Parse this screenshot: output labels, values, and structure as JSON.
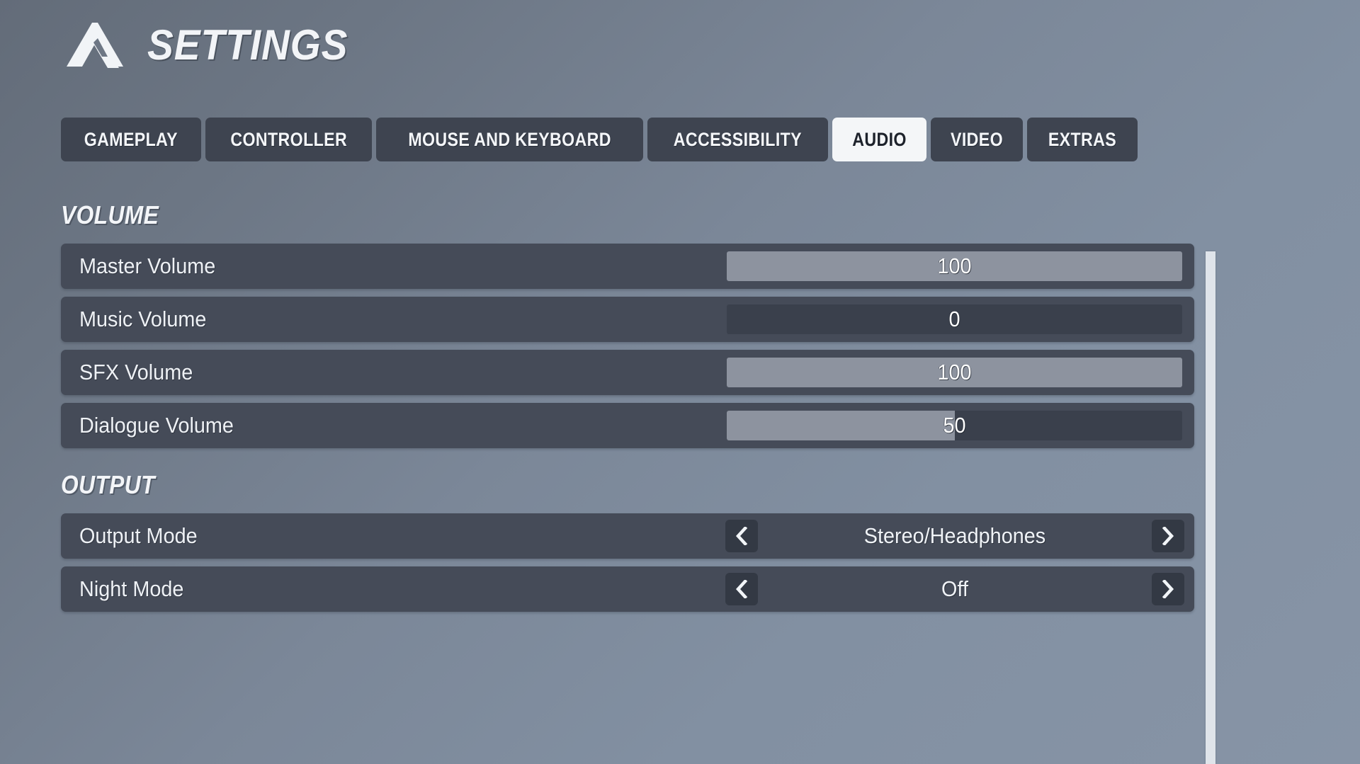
{
  "header": {
    "title": "SETTINGS",
    "logo_icon": "mountain-peak-logo-icon"
  },
  "tabs": [
    {
      "label": "GAMEPLAY",
      "active": false
    },
    {
      "label": "CONTROLLER",
      "active": false
    },
    {
      "label": "MOUSE AND KEYBOARD",
      "active": false
    },
    {
      "label": "ACCESSIBILITY",
      "active": false
    },
    {
      "label": "AUDIO",
      "active": true
    },
    {
      "label": "VIDEO",
      "active": false
    },
    {
      "label": "EXTRAS",
      "active": false
    }
  ],
  "sections": {
    "volume": {
      "title": "VOLUME",
      "rows": [
        {
          "label": "Master Volume",
          "value": "100",
          "percent": 100
        },
        {
          "label": "Music Volume",
          "value": "0",
          "percent": 0
        },
        {
          "label": "SFX Volume",
          "value": "100",
          "percent": 100
        },
        {
          "label": "Dialogue Volume",
          "value": "50",
          "percent": 50
        }
      ]
    },
    "output": {
      "title": "OUTPUT",
      "rows": [
        {
          "label": "Output Mode",
          "value": "Stereo/Headphones"
        },
        {
          "label": "Night Mode",
          "value": "Off"
        }
      ]
    }
  },
  "controls": {
    "prev_icon": "chevron-left-icon",
    "next_icon": "chevron-right-icon"
  },
  "colors": {
    "row_background": "#454b58",
    "slider_fill": "#8d939f",
    "slider_track": "#3a404c",
    "tab_background": "#3e4450",
    "tab_active_background": "#f4f6f8",
    "text_primary": "#eef1f5",
    "scrollbar_thumb": "#dfe4ea"
  }
}
